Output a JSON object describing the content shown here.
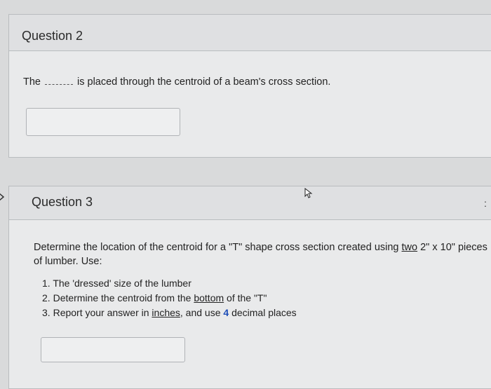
{
  "question2": {
    "title": "Question 2",
    "prompt_before": "The",
    "prompt_after": "is placed through the centroid of a beam's cross section.",
    "answer_value": ""
  },
  "question3": {
    "title": "Question 3",
    "intro_part1": "Determine the location of the centroid for a \"T\" shape cross section created using ",
    "intro_underlined": "two",
    "intro_part2": " 2\" x 10\" pieces of lumber.  Use:",
    "items": [
      {
        "number": "1.",
        "text_before": " The 'dressed' size of the lumber",
        "underlined": "",
        "text_after": ""
      },
      {
        "number": "2.",
        "text_before": " Determine the centroid from the ",
        "underlined": "bottom",
        "text_after": " of the \"T\""
      },
      {
        "number": "3.",
        "text_before": " Report your answer in ",
        "underlined": "inches",
        "text_after": ", and use ",
        "highlight": "4",
        "text_end": " decimal places"
      }
    ],
    "answer_value": ""
  },
  "icons": {
    "collapse_arrow": "chevron-right-icon",
    "cursor": "mouse-pointer-icon",
    "side_marker": ":"
  }
}
